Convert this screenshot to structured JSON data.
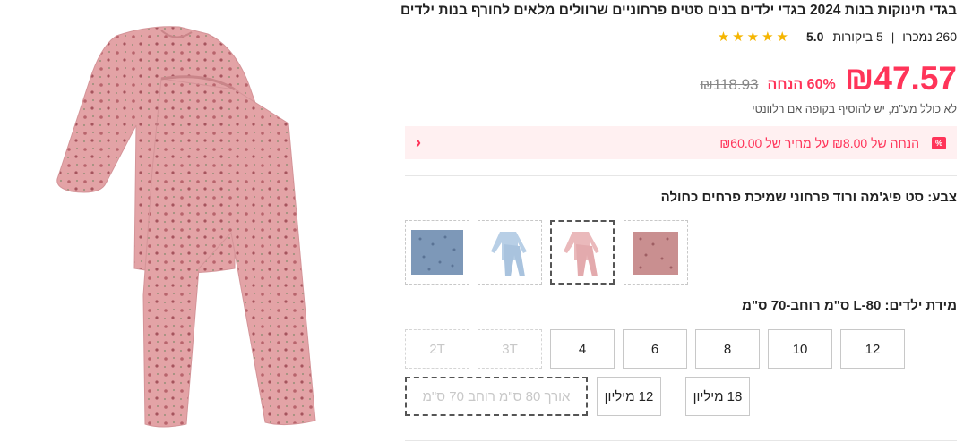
{
  "product": {
    "title": "בגדי תינוקות בנות 2024 בגדי ילדים בנים סטים פרחוניים שרוולים מלאים לחורף בנות ילדים",
    "rating": {
      "score": "5.0",
      "reviews": "5 ביקורות",
      "separator": "|",
      "sold": "260 נמכרו",
      "star_count": 5,
      "star_color": "#f5b500"
    },
    "price": {
      "current": "₪47.57",
      "discount": "60% הנחה",
      "original": "₪118.93",
      "accent_color": "#ff3459"
    },
    "tax_note": "לא כולל מע\"מ, יש להוסיף בקופה אם רלוונטי",
    "promo": {
      "text": "הנחה של ₪8.00 על מחיר של ₪60.00",
      "badge_icon": "%",
      "chevron_icon": "‹",
      "background": "#fff0f1"
    },
    "color": {
      "label": "צבע: סט פיג'מה ורוד פרחוני שמיכת פרחים כחולה",
      "swatches": [
        {
          "name": "blue-floral-blanket",
          "selected": false
        },
        {
          "name": "light-blue-pajama-set",
          "selected": false
        },
        {
          "name": "pink-pajama-set",
          "selected": true
        },
        {
          "name": "pink-floral-blanket",
          "selected": false
        }
      ]
    },
    "size": {
      "label": "מידת ילדים: L-80 ס\"מ רוחב-70 ס\"מ",
      "options": [
        {
          "label": "2T",
          "available": false
        },
        {
          "label": "3T",
          "available": false
        },
        {
          "label": "4",
          "available": true
        },
        {
          "label": "6",
          "available": true
        },
        {
          "label": "8",
          "available": true
        },
        {
          "label": "10",
          "available": true
        },
        {
          "label": "12",
          "available": true
        },
        {
          "label": "אורך 80 ס\"מ רוחב 70 ס\"מ",
          "available": false,
          "selected": true
        },
        {
          "label": "12 מיליון",
          "available": true
        },
        {
          "label": "18 מיליון",
          "available": true
        }
      ]
    }
  }
}
